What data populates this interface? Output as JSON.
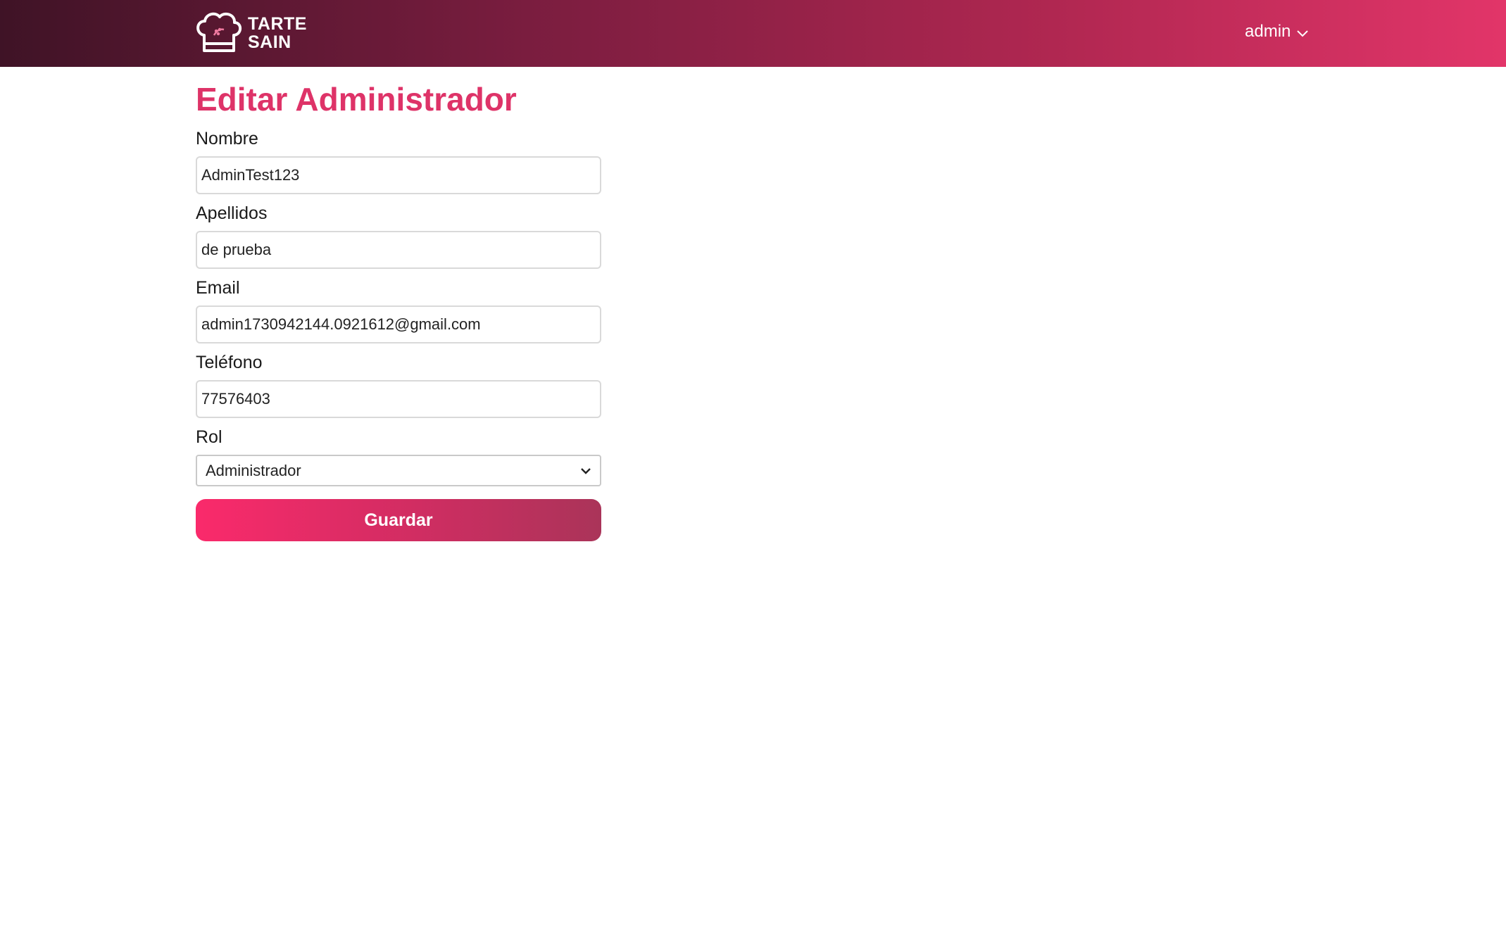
{
  "header": {
    "brand_line1": "TARTE",
    "brand_line2": "SAIN",
    "logo_icon": "chef-hat-icon",
    "user_label": "admin",
    "user_menu_icon": "chevron-down-icon"
  },
  "page": {
    "title": "Editar Administrador"
  },
  "form": {
    "nombre": {
      "label": "Nombre",
      "value": "AdminTest123"
    },
    "apellidos": {
      "label": "Apellidos",
      "value": "de prueba"
    },
    "email": {
      "label": "Email",
      "value": "admin1730942144.0921612@gmail.com"
    },
    "telefono": {
      "label": "Teléfono",
      "value": "77576403"
    },
    "rol": {
      "label": "Rol",
      "selected": "Administrador",
      "icon": "chevron-down-icon"
    },
    "submit_label": "Guardar"
  },
  "colors": {
    "accent": "#de3368",
    "header_start": "#3f1326",
    "header_end": "#e23569",
    "button_start": "#fa2a6b",
    "button_end": "#aa3459"
  }
}
